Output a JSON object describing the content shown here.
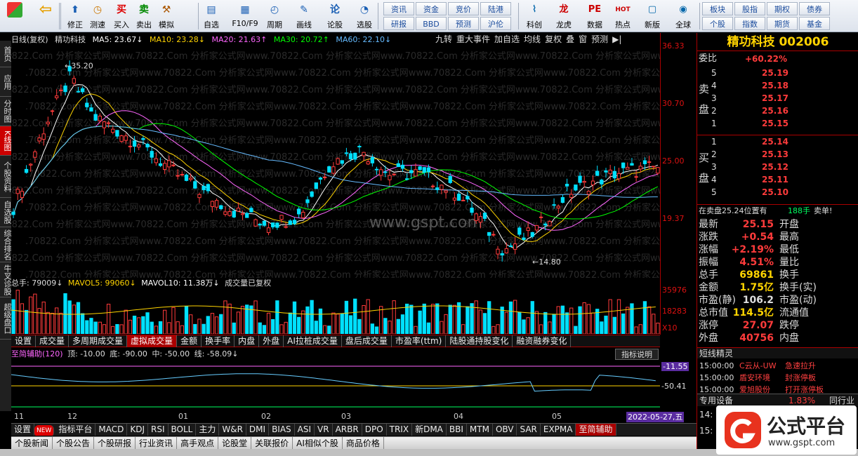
{
  "toolbar": {
    "big": [
      {
        "label": "修正",
        "icon": "⬆"
      },
      {
        "label": "测速",
        "icon": "◷"
      },
      {
        "label": "买入",
        "icon": "买"
      },
      {
        "label": "卖出",
        "icon": "卖"
      },
      {
        "label": "模拟",
        "icon": "⚒"
      },
      {
        "label": "自选",
        "icon": "▤"
      },
      {
        "label": "F10/F9",
        "icon": "▦"
      },
      {
        "label": "周期",
        "icon": "◴"
      },
      {
        "label": "画线",
        "icon": "✎"
      },
      {
        "label": "论股",
        "icon": "论"
      },
      {
        "label": "选股",
        "icon": "◔"
      }
    ],
    "small": [
      [
        "资讯",
        "资金",
        "竞价",
        "陆港"
      ],
      [
        "研报",
        "BBD",
        "预测",
        "沪伦"
      ]
    ],
    "big2": [
      {
        "label": "科创",
        "icon": "⌇"
      },
      {
        "label": "龙虎",
        "icon": "龙"
      },
      {
        "label": "数据",
        "icon": "PE"
      },
      {
        "label": "热点",
        "icon": "HOT"
      },
      {
        "label": "新版",
        "icon": "▢"
      },
      {
        "label": "全球",
        "icon": "◉"
      }
    ],
    "small2": [
      [
        "板块",
        "股指",
        "期权",
        "债券"
      ],
      [
        "个股",
        "指数",
        "期货",
        "基金"
      ]
    ]
  },
  "lefttabs": [
    "首页",
    "应用",
    "分时图",
    "K线图",
    "个股资料",
    "自选股",
    "综合排名",
    "牛叉诊股",
    "超级盘口"
  ],
  "header": {
    "label": "日线(复权)",
    "name": "精功科技",
    "ma5": "MA5: 23.67↓",
    "ma10": "MA10: 23.28↓",
    "ma20": "MA20: 21.63↑",
    "ma30": "MA30: 20.72↑",
    "ma60": "MA60: 22.10↓"
  },
  "hbtns": [
    "九转",
    "重大事件",
    "加自选",
    "均线",
    "复权",
    "叠",
    "窗",
    "预测",
    "▶|"
  ],
  "price_axis": [
    "36.33",
    "30.70",
    "25.00",
    "19.37"
  ],
  "vol_axis": [
    "35976",
    "18283",
    "X10"
  ],
  "annotations": {
    "high": "35.20",
    "low": "14.80"
  },
  "watermark": "www.gspt.com",
  "volhdr": {
    "a": "总手: 79009↓",
    "b": "MAVOL5: 99060↓",
    "c": "MAVOL10: 11.38万↓",
    "d": "成交量已复权"
  },
  "vtabs": [
    "设置",
    "成交量",
    "多周期成交量",
    "虚拟成交量",
    "金额",
    "换手率",
    "内盘",
    "外盘",
    "AI拉桩成交量",
    "盘后成交量",
    "市盈率(ttm)",
    "陆股通持股变化",
    "融资融券变化"
  ],
  "indhdr": {
    "a": "至简辅助(120)",
    "b": "顶: -10.00",
    "c": "底: -90.00",
    "d": "中: -50.00",
    "e": "线: -58.09↓"
  },
  "indexplain": "指标说明",
  "ind_axis": [
    "-11.55",
    "-50.41"
  ],
  "dates": [
    "11",
    "12",
    "01",
    "02",
    "03",
    "04",
    "05"
  ],
  "datebadge": "2022-05-27,五",
  "itabs": [
    "设置",
    "NEW",
    "指标平台",
    "MACD",
    "KDJ",
    "RSI",
    "BOLL",
    "主力",
    "W&R",
    "DMI",
    "BIAS",
    "ASI",
    "VR",
    "ARBR",
    "DPO",
    "TRIX",
    "新DMA",
    "BBI",
    "MTM",
    "OBV",
    "SAR",
    "EXPMA",
    "至简辅助"
  ],
  "btabs": [
    "个股新闻",
    "个股公告",
    "个股研报",
    "行业资讯",
    "高手观点",
    "论股堂",
    "关联报价",
    "AI相似个股",
    "商品价格"
  ],
  "right": {
    "title": "精功科技 002006",
    "weibi_label": "委比",
    "weibi": "+60.22%",
    "sell_label": "卖盘",
    "buy_label": "买盘",
    "sell": [
      [
        "5",
        "25.19"
      ],
      [
        "4",
        "25.18"
      ],
      [
        "3",
        "25.17"
      ],
      [
        "2",
        "25.16"
      ],
      [
        "1",
        "25.15"
      ]
    ],
    "buy": [
      [
        "1",
        "25.14"
      ],
      [
        "2",
        "25.13"
      ],
      [
        "3",
        "25.12"
      ],
      [
        "4",
        "25.11"
      ],
      [
        "5",
        "25.10"
      ]
    ],
    "trade_hint": "在卖盘25.24位置有",
    "trade_hint_qty": "188手",
    "trade_hint_act": "卖单!",
    "left_kv": [
      [
        "最新",
        "25.15",
        "#ff3b3b"
      ],
      [
        "涨跌",
        "+0.54",
        "#ff3b3b"
      ],
      [
        "涨幅",
        "+2.19%",
        "#ff3b3b"
      ],
      [
        "振幅",
        "4.51%",
        "#ff3b3b"
      ],
      [
        "总手",
        "69861",
        "#ffd400"
      ],
      [
        "金额",
        "1.75亿",
        "#ffd400"
      ],
      [
        "市盈(静)",
        "106.2",
        "#ddd"
      ],
      [
        "总市值",
        "114.5亿",
        "#ffd400"
      ],
      [
        "涨停",
        "27.07",
        "#ff3b3b"
      ],
      [
        "外盘",
        "40756",
        "#ff3b3b"
      ]
    ],
    "right_kv": [
      "开盘",
      "最高",
      "最低",
      "量比",
      "换手",
      "换手(实)",
      "市盈(动)",
      "流通值",
      "跌停",
      "内盘"
    ],
    "dx_title": "短线精灵",
    "dx": [
      [
        "15:00:00",
        "C云从-UW",
        "急速拉升"
      ],
      [
        "15:00:00",
        "盾安环境",
        "封涨停板"
      ],
      [
        "15:00:00",
        "爱旭股份",
        "打开涨停板"
      ]
    ],
    "equip_label": "专用设备",
    "equip_val": "1.83%",
    "equip_more": "同行业",
    "time": "14:",
    "time2": "15:"
  },
  "logo": {
    "text": "公式平台",
    "url": "www.gspt.com"
  },
  "colors": {
    "up": "#ff3b3b",
    "down": "#00e0ff",
    "ma5": "#ffffff",
    "ma10": "#ffd400",
    "ma20": "#ff66ff",
    "ma30": "#00ff00",
    "ma60": "#66bbff"
  }
}
